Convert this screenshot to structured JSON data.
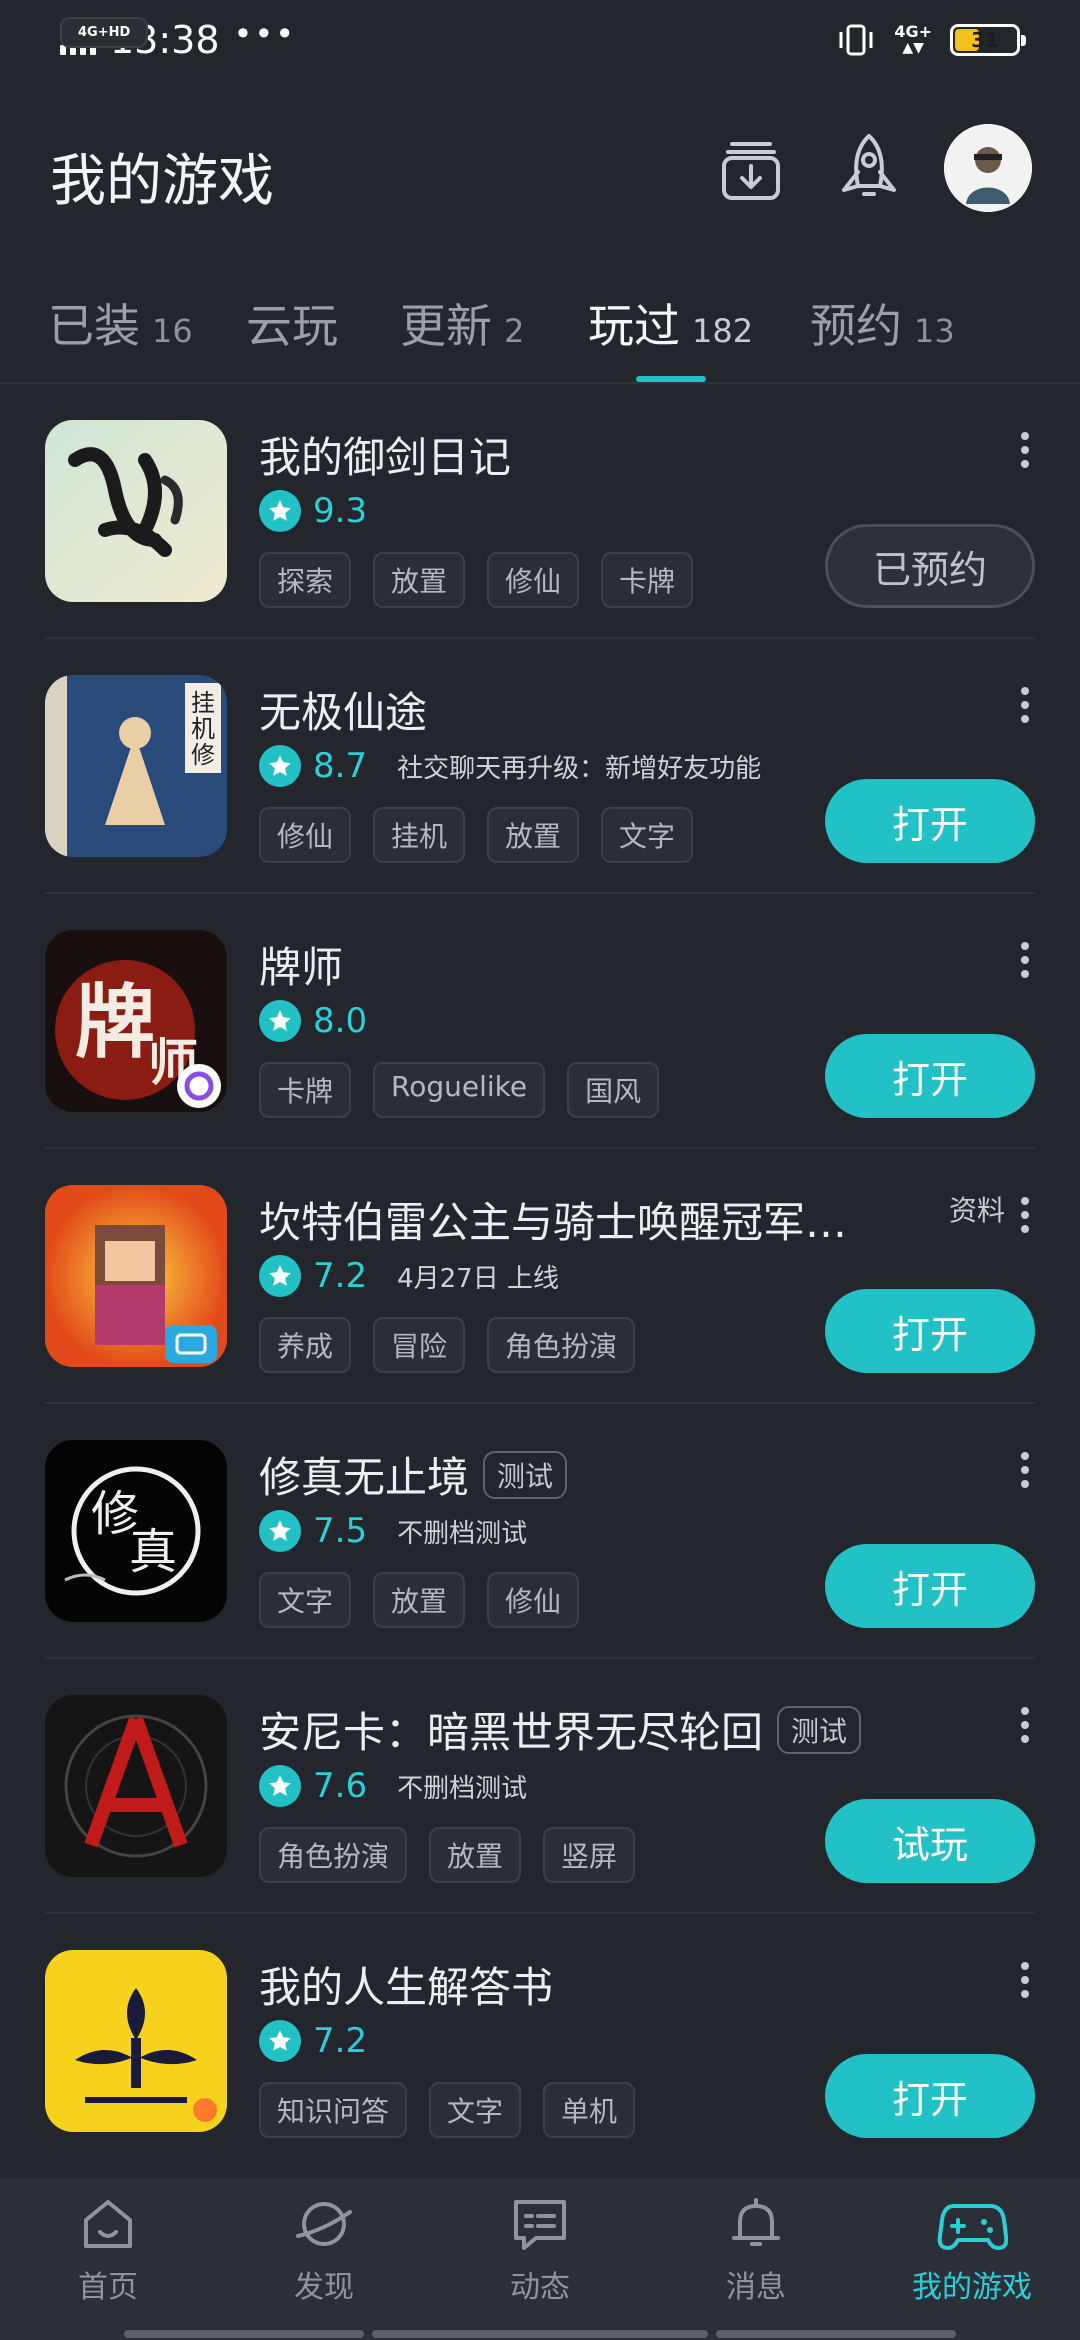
{
  "status_bar": {
    "network_tag": "4G+HD",
    "time": "13:38",
    "dots": "•••",
    "net_right": "4G+",
    "battery": "31"
  },
  "header": {
    "title": "我的游戏"
  },
  "tabs": [
    {
      "label": "已装",
      "count": "16"
    },
    {
      "label": "云玩",
      "count": ""
    },
    {
      "label": "更新",
      "count": "2"
    },
    {
      "label": "玩过",
      "count": "182"
    },
    {
      "label": "预约",
      "count": "13"
    }
  ],
  "games": [
    {
      "title": "我的御剑日记",
      "score": "9.3",
      "note": "",
      "tags": [
        "探索",
        "放置",
        "修仙",
        "卡牌"
      ],
      "action": "已预约",
      "badge": "",
      "info": ""
    },
    {
      "title": "无极仙途",
      "score": "8.7",
      "note": "社交聊天再升级：新增好友功能",
      "tags": [
        "修仙",
        "挂机",
        "放置",
        "文字"
      ],
      "action": "打开",
      "badge": "",
      "info": ""
    },
    {
      "title": "牌师",
      "score": "8.0",
      "note": "",
      "tags": [
        "卡牌",
        "Roguelike",
        "国风"
      ],
      "action": "打开",
      "badge": "",
      "info": ""
    },
    {
      "title": "坎特伯雷公主与骑士唤醒冠军…",
      "score": "7.2",
      "note": "4月27日 上线",
      "tags": [
        "养成",
        "冒险",
        "角色扮演"
      ],
      "action": "打开",
      "badge": "",
      "info": "资料"
    },
    {
      "title": "修真无止境",
      "score": "7.5",
      "note": "不删档测试",
      "tags": [
        "文字",
        "放置",
        "修仙"
      ],
      "action": "打开",
      "badge": "测试",
      "info": ""
    },
    {
      "title": "安尼卡：暗黑世界无尽轮回",
      "score": "7.6",
      "note": "不删档测试",
      "tags": [
        "角色扮演",
        "放置",
        "竖屏"
      ],
      "action": "试玩",
      "badge": "测试",
      "info": ""
    },
    {
      "title": "我的人生解答书",
      "score": "7.2",
      "note": "",
      "tags": [
        "知识问答",
        "文字",
        "单机"
      ],
      "action": "打开",
      "badge": "",
      "info": ""
    }
  ],
  "bottom_nav": [
    {
      "label": "首页",
      "icon": "home-icon"
    },
    {
      "label": "发现",
      "icon": "planet-icon"
    },
    {
      "label": "动态",
      "icon": "message-card-icon"
    },
    {
      "label": "消息",
      "icon": "bell-icon"
    },
    {
      "label": "我的游戏",
      "icon": "gamepad-icon"
    }
  ],
  "colors": {
    "accent": "#22c1c6",
    "background": "#23262d",
    "battery": "#f4c21a"
  }
}
